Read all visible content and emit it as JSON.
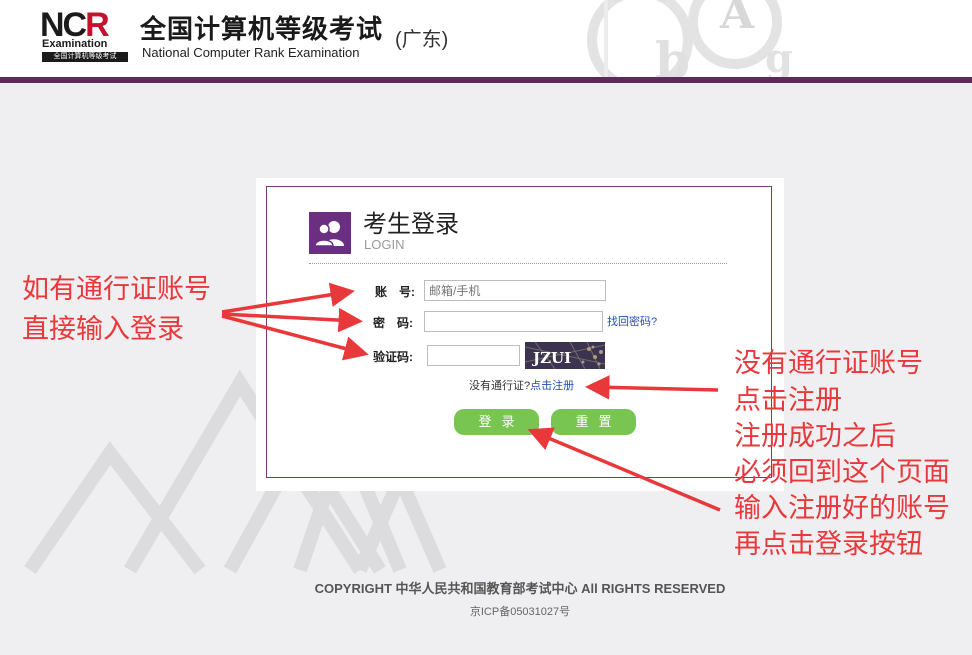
{
  "header": {
    "logo_mark": "NCR",
    "logo_text": "Examination",
    "logo_sub": "全国计算机等级考试",
    "title": "全国计算机等级考试",
    "subtitle": "National Computer Rank Examination",
    "region": "(广东)"
  },
  "login": {
    "title": "考生登录",
    "subtitle": "LOGIN",
    "account_label": "账　号:",
    "account_placeholder": "邮箱/手机",
    "password_label": "密　码:",
    "find_password": "找回密码?",
    "captcha_label": "验证码:",
    "captcha_text": "JZUI",
    "no_account_prefix": "没有通行证?",
    "register_link": "点击注册",
    "login_button": "登录",
    "reset_button": "重置"
  },
  "footer": {
    "copyright": "COPYRIGHT 中华人民共和国教育部考试中心 All RIGHTS RESERVED",
    "icp": "京ICP备05031027号"
  },
  "annotations": {
    "left": [
      "如有通行证账号",
      "直接输入登录"
    ],
    "right": [
      "没有通行证账号",
      "点击注册",
      "注册成功之后",
      "必须回到这个页面",
      "输入注册好的账号",
      "再点击登录按钮"
    ]
  },
  "colors": {
    "header_bar": "#5e2a59",
    "login_icon": "#6b2f82",
    "button": "#79c552",
    "annotation": "#e8383a"
  }
}
